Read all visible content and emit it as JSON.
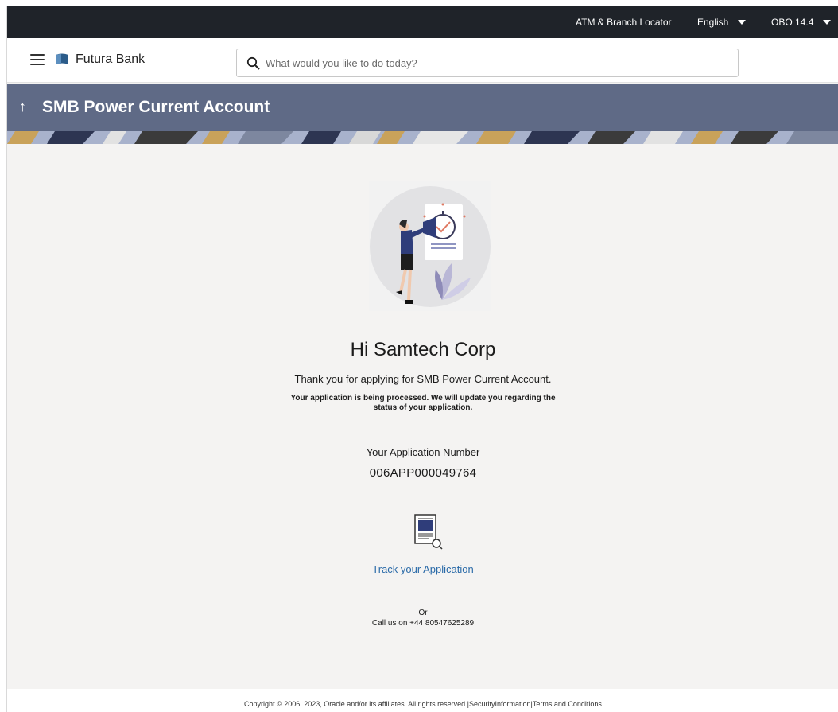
{
  "topbar": {
    "locator_label": "ATM & Branch Locator",
    "language_label": "English",
    "version_label": "OBO 14.4"
  },
  "header": {
    "brand_name": "Futura Bank",
    "search_placeholder": "What would you like to do today?"
  },
  "page": {
    "title": "SMB Power Current Account"
  },
  "confirmation": {
    "greeting": "Hi Samtech Corp",
    "thank_you": "Thank you for applying for SMB Power Current Account.",
    "processing_line1": "Your application is being processed. We will update you regarding the",
    "processing_line2": "status of your application.",
    "app_number_label": "Your Application Number",
    "app_number": "006APP000049764",
    "track_link": "Track your Application",
    "or_text": "Or",
    "call_text": "Call us on +44 80547625289"
  },
  "footer": {
    "copyright": "Copyright © 2006, 2023, Oracle and/or its affiliates. All rights reserved.|",
    "security_link": "SecurityInformation",
    "separator": "|",
    "terms_link": "Terms and Conditions"
  },
  "colors": {
    "topbar_bg": "#1f2329",
    "title_band_bg": "#5f6a86",
    "link": "#2a6aa8",
    "page_bg": "#f4f3f2"
  },
  "icons": [
    "menu-icon",
    "bank-logo-icon",
    "search-icon",
    "back-arrow-icon",
    "document-search-icon"
  ]
}
